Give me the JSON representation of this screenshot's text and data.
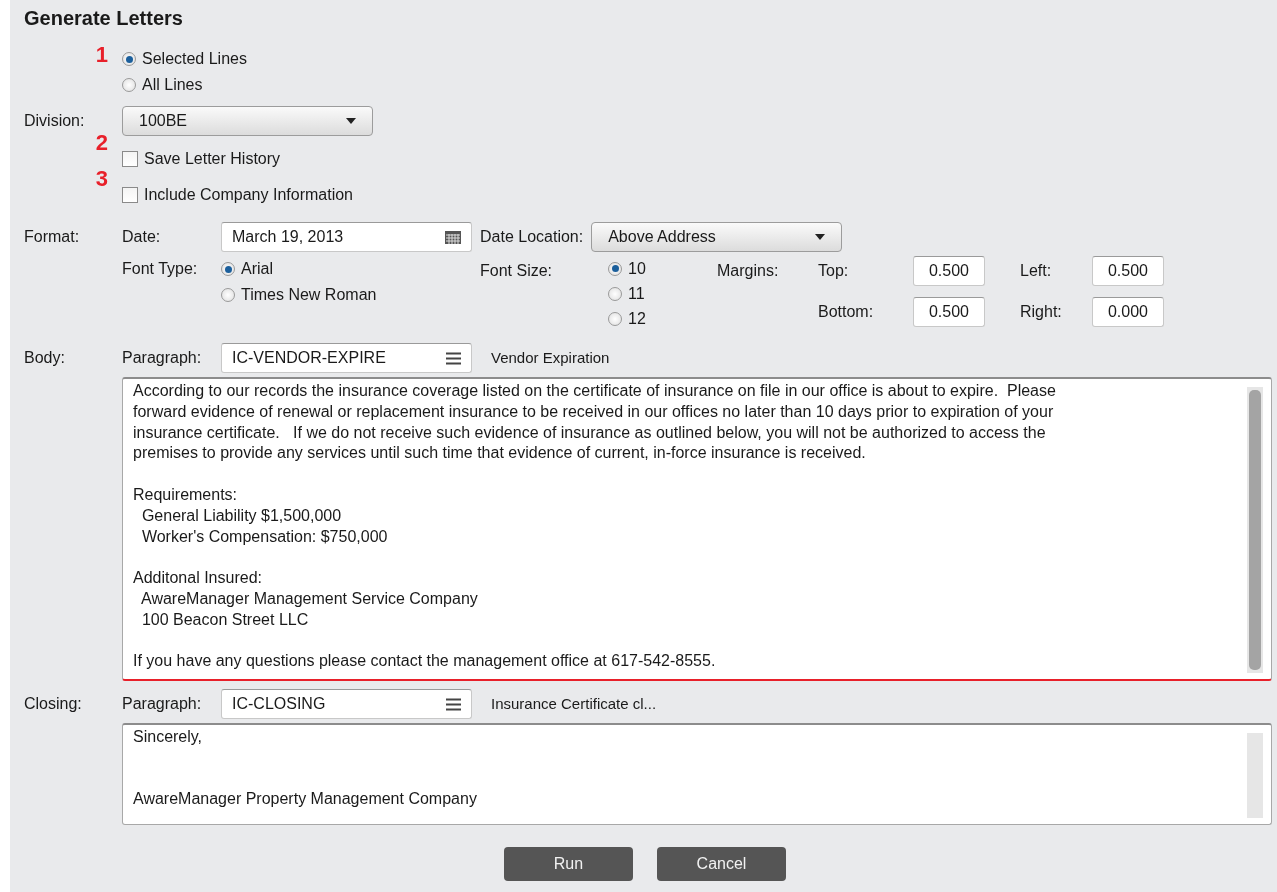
{
  "title": "Generate Letters",
  "line_scope": {
    "marker": "1",
    "options": [
      {
        "label": "Selected Lines",
        "selected": true
      },
      {
        "label": "All Lines",
        "selected": false
      }
    ]
  },
  "division": {
    "label": "Division:",
    "value": "100BE"
  },
  "options": [
    {
      "marker": "2",
      "label": "Save Letter History",
      "checked": false
    },
    {
      "marker": "3",
      "label": "Include Company Information",
      "checked": false
    }
  ],
  "format": {
    "label": "Format:",
    "date": {
      "label": "Date:",
      "value": "March 19, 2013"
    },
    "date_location": {
      "label": "Date Location:",
      "value": "Above Address"
    },
    "font_type": {
      "label": "Font Type:",
      "options": [
        {
          "label": "Arial",
          "selected": true
        },
        {
          "label": "Times New Roman",
          "selected": false
        }
      ]
    },
    "font_size": {
      "label": "Font Size:",
      "options": [
        {
          "label": "10",
          "selected": true
        },
        {
          "label": "11",
          "selected": false
        },
        {
          "label": "12",
          "selected": false
        }
      ]
    },
    "margins": {
      "label": "Margins:",
      "fields": [
        {
          "label": "Top:",
          "value": "0.500"
        },
        {
          "label": "Left:",
          "value": "0.500"
        },
        {
          "label": "Bottom:",
          "value": "0.500"
        },
        {
          "label": "Right:",
          "value": "0.000"
        }
      ]
    }
  },
  "body": {
    "label": "Body:",
    "paragraph_label": "Paragraph:",
    "paragraph_code": "IC-VENDOR-EXPIRE",
    "paragraph_name": "Vendor Expiration",
    "paragraphs": [
      [
        "According to our records the insurance coverage listed on the certificate of insurance on file in our office is about to expire.  Please",
        "forward evidence of renewal or replacement insurance to be received in our offices no later than 10 days prior to expiration of your",
        "insurance certificate.   If we do not receive such evidence of insurance as outlined below, you will not be authorized to access the",
        "premises to provide any services until such time that evidence of current, in-force insurance is received."
      ],
      [
        "Requirements:",
        "  General Liability $1,500,000",
        "  Worker's Compensation: $750,000"
      ],
      [
        "Additonal Insured:",
        "  AwareManager Management Service Company",
        "  100 Beacon Street LLC"
      ],
      [
        "If you have any questions please contact the management office at 617-542-8555."
      ]
    ]
  },
  "closing": {
    "label": "Closing:",
    "paragraph_label": "Paragraph:",
    "paragraph_code": "IC-CLOSING",
    "paragraph_name": "Insurance Certificate cl...",
    "paragraphs": [
      [
        "Sincerely,"
      ],
      [
        "AwareManager Property Management Company"
      ]
    ]
  },
  "buttons": [
    "Run",
    "Cancel"
  ]
}
